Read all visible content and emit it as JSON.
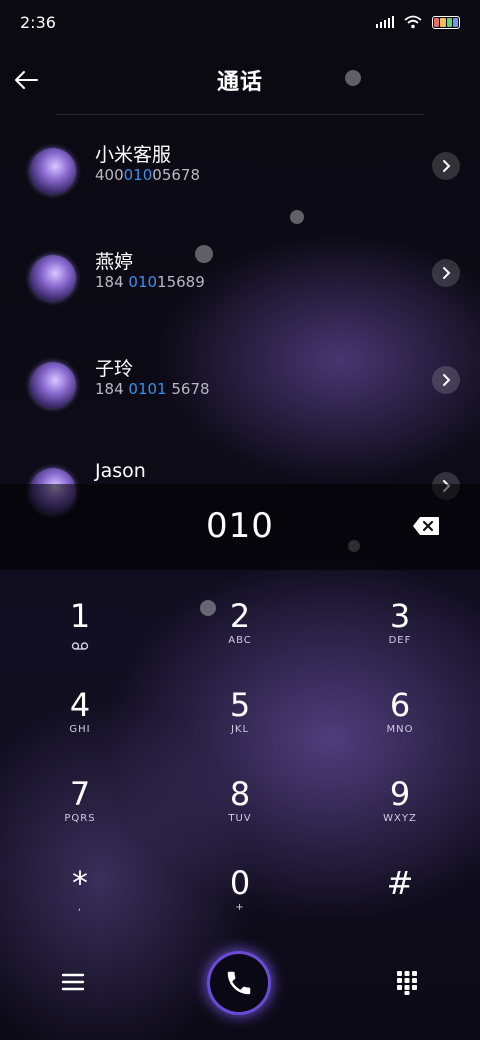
{
  "status": {
    "time": "2:36"
  },
  "header": {
    "title": "通话"
  },
  "contacts": [
    {
      "name": "小米客服",
      "num_pre": "400",
      "num_hl": "010",
      "num_post": "05678"
    },
    {
      "name": "燕婷",
      "num_pre": "184 ",
      "num_hl": "010",
      "num_post": "15689"
    },
    {
      "name": "子玲",
      "num_pre": "184 ",
      "num_hl": "0101",
      "num_post": " 5678"
    },
    {
      "name": "Jason",
      "num_pre": "",
      "num_hl": "",
      "num_post": ""
    }
  ],
  "dial": {
    "input": "010"
  },
  "keys": [
    {
      "digit": "1",
      "letters": ""
    },
    {
      "digit": "2",
      "letters": "ABC"
    },
    {
      "digit": "3",
      "letters": "DEF"
    },
    {
      "digit": "4",
      "letters": "GHI"
    },
    {
      "digit": "5",
      "letters": "JKL"
    },
    {
      "digit": "6",
      "letters": "MNO"
    },
    {
      "digit": "7",
      "letters": "PQRS"
    },
    {
      "digit": "8",
      "letters": "TUV"
    },
    {
      "digit": "9",
      "letters": "WXYZ"
    },
    {
      "digit": "*",
      "letters": ","
    },
    {
      "digit": "0",
      "letters": "+"
    },
    {
      "digit": "#",
      "letters": ""
    }
  ],
  "colors": {
    "accent": "#3a8fe8",
    "call_ring": "#6a4bd6"
  },
  "icons": {
    "back": "back-arrow-icon",
    "chevron": "chevron-right-icon",
    "delete": "backspace-icon",
    "voicemail": "voicemail-icon",
    "menu": "menu-icon",
    "call": "phone-icon",
    "dialpad": "dialpad-icon"
  }
}
